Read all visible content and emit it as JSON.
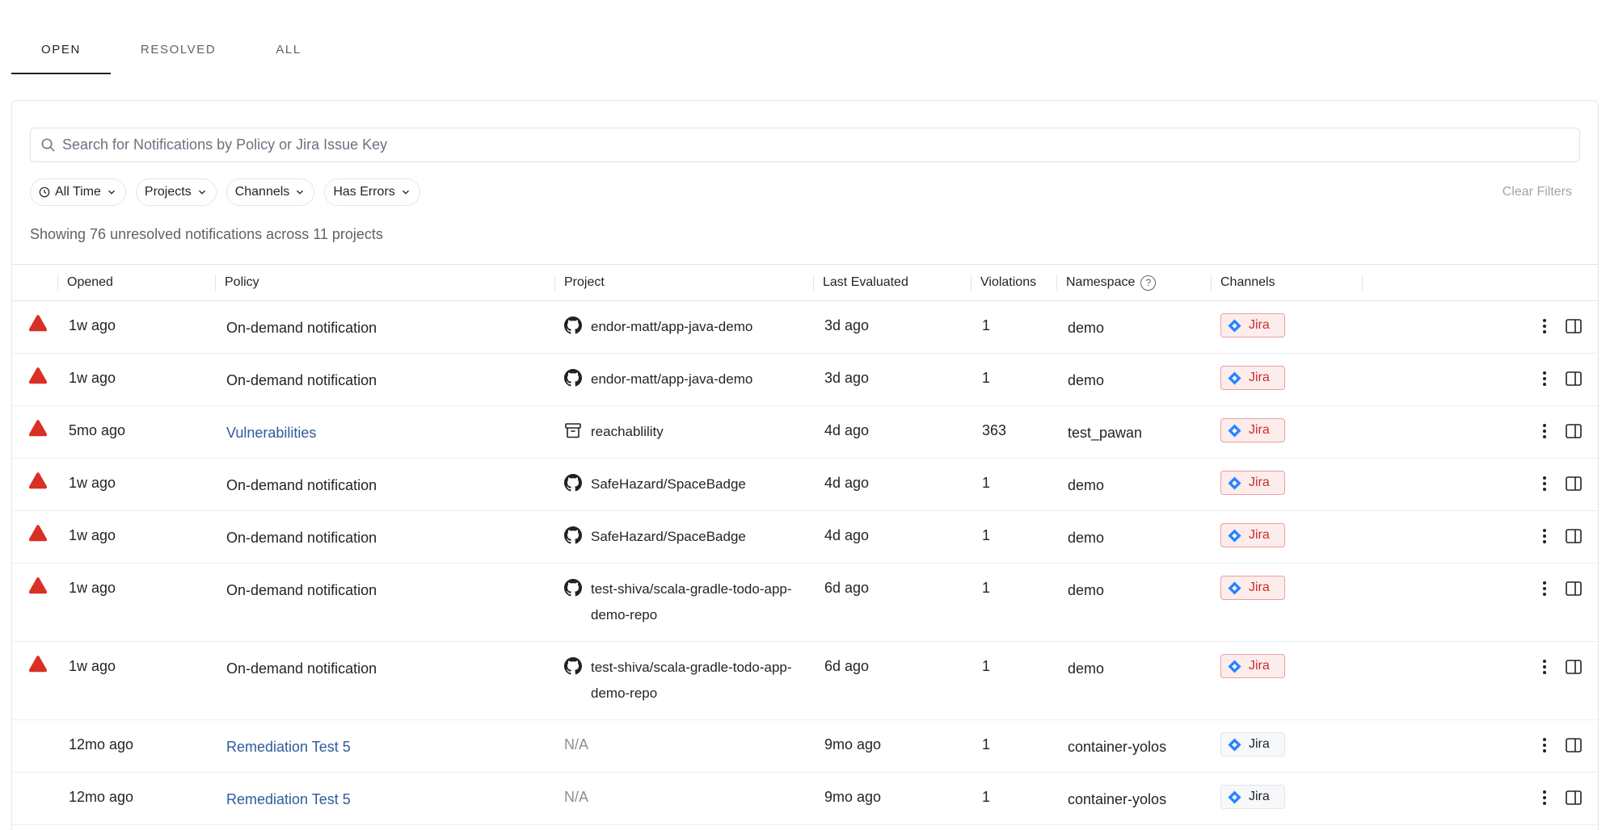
{
  "tabs": [
    {
      "label": "OPEN",
      "active": true
    },
    {
      "label": "RESOLVED",
      "active": false
    },
    {
      "label": "ALL",
      "active": false
    }
  ],
  "search": {
    "placeholder": "Search for Notifications by Policy or Jira Issue Key",
    "value": ""
  },
  "filters": {
    "time": "All Time",
    "projects": "Projects",
    "channels": "Channels",
    "errors": "Has Errors",
    "clear": "Clear Filters"
  },
  "summary": "Showing 76 unresolved notifications across 11 projects",
  "columns": {
    "opened": "Opened",
    "policy": "Policy",
    "project": "Project",
    "last_evaluated": "Last Evaluated",
    "violations": "Violations",
    "namespace": "Namespace",
    "channels": "Channels"
  },
  "colors": {
    "error": "#d93025",
    "link": "#2f5b9c",
    "jira": "#2684ff"
  },
  "rows": [
    {
      "warn": true,
      "opened": "1w ago",
      "policy": "On-demand notification",
      "policy_link": false,
      "project_icon": "github-icon",
      "project": "endor-matt/app-java-demo",
      "last_evaluated": "3d ago",
      "violations": "1",
      "namespace": "demo",
      "channel": "Jira",
      "channel_error": true
    },
    {
      "warn": true,
      "opened": "1w ago",
      "policy": "On-demand notification",
      "policy_link": false,
      "project_icon": "github-icon",
      "project": "endor-matt/app-java-demo",
      "last_evaluated": "3d ago",
      "violations": "1",
      "namespace": "demo",
      "channel": "Jira",
      "channel_error": true
    },
    {
      "warn": true,
      "opened": "5mo ago",
      "policy": "Vulnerabilities",
      "policy_link": true,
      "project_icon": "package-icon",
      "project": "reachablility",
      "last_evaluated": "4d ago",
      "violations": "363",
      "namespace": "test_pawan",
      "channel": "Jira",
      "channel_error": true
    },
    {
      "warn": true,
      "opened": "1w ago",
      "policy": "On-demand notification",
      "policy_link": false,
      "project_icon": "github-icon",
      "project": "SafeHazard/SpaceBadge",
      "last_evaluated": "4d ago",
      "violations": "1",
      "namespace": "demo",
      "channel": "Jira",
      "channel_error": true
    },
    {
      "warn": true,
      "opened": "1w ago",
      "policy": "On-demand notification",
      "policy_link": false,
      "project_icon": "github-icon",
      "project": "SafeHazard/SpaceBadge",
      "last_evaluated": "4d ago",
      "violations": "1",
      "namespace": "demo",
      "channel": "Jira",
      "channel_error": true
    },
    {
      "warn": true,
      "opened": "1w ago",
      "policy": "On-demand notification",
      "policy_link": false,
      "project_icon": "github-icon",
      "project": "test-shiva/scala-gradle-todo-app-demo-repo",
      "last_evaluated": "6d ago",
      "violations": "1",
      "namespace": "demo",
      "channel": "Jira",
      "channel_error": true
    },
    {
      "warn": true,
      "opened": "1w ago",
      "policy": "On-demand notification",
      "policy_link": false,
      "project_icon": "github-icon",
      "project": "test-shiva/scala-gradle-todo-app-demo-repo",
      "last_evaluated": "6d ago",
      "violations": "1",
      "namespace": "demo",
      "channel": "Jira",
      "channel_error": true
    },
    {
      "warn": false,
      "opened": "12mo ago",
      "policy": "Remediation Test 5",
      "policy_link": true,
      "project_icon": "",
      "project": "N/A",
      "last_evaluated": "9mo ago",
      "violations": "1",
      "namespace": "container-yolos",
      "channel": "Jira",
      "channel_error": false
    },
    {
      "warn": false,
      "opened": "12mo ago",
      "policy": "Remediation Test 5",
      "policy_link": true,
      "project_icon": "",
      "project": "N/A",
      "last_evaluated": "9mo ago",
      "violations": "1",
      "namespace": "container-yolos",
      "channel": "Jira",
      "channel_error": false
    }
  ]
}
